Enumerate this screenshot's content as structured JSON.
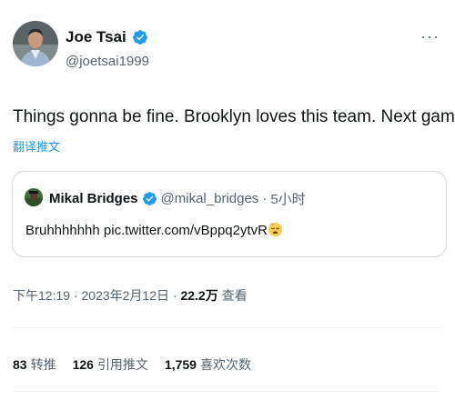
{
  "author": {
    "name": "Joe Tsai",
    "handle": "@joetsai1999",
    "avatar_icon": "person-avatar-icon"
  },
  "more_menu": "···",
  "tweet": {
    "text": "Things gonna be fine. Brooklyn loves this team. Next game.",
    "translate_label": "翻译推文"
  },
  "quoted_tweet": {
    "name": "Mikal Bridges",
    "handle": "@mikal_bridges",
    "separator": "·",
    "time": "5小时",
    "text": "Bruhhhhhhh pic.twitter.com/vBppq2ytvR",
    "emoji_icon": "sleepy-face-emoji-icon"
  },
  "meta": {
    "time": "下午12:19",
    "sep1": "·",
    "date": "2023年2月12日",
    "sep2": "·",
    "views_count": "22.2万",
    "views_label": "查看"
  },
  "stats": [
    {
      "count": "83",
      "label": "转推"
    },
    {
      "count": "126",
      "label": "引用推文"
    },
    {
      "count": "1,759",
      "label": "喜欢次数"
    }
  ],
  "colors": {
    "accent": "#1d9bf0",
    "text": "#0f1419",
    "secondary": "#536471",
    "border": "#cfd9de"
  }
}
